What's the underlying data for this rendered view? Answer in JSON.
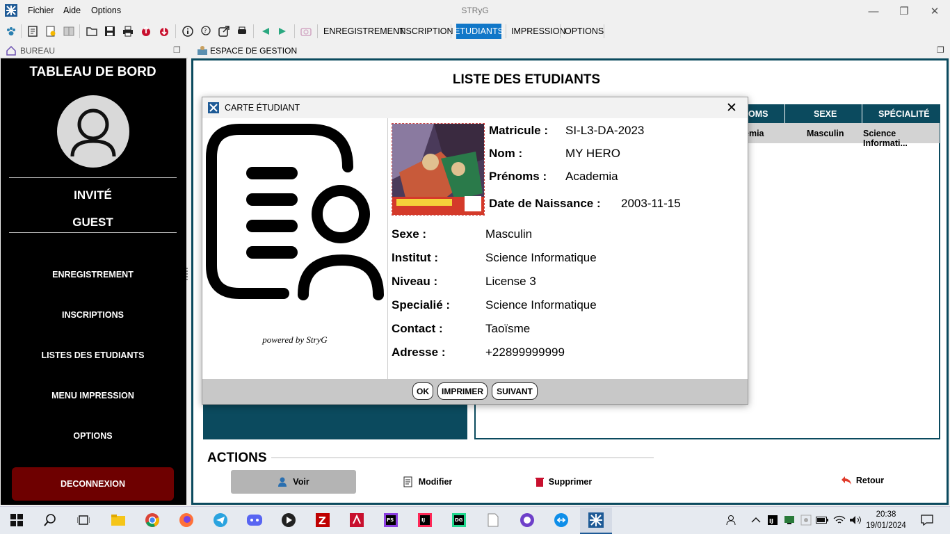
{
  "window": {
    "title": "STRyG",
    "menu": [
      "Fichier",
      "Aide",
      "Options"
    ]
  },
  "toolbar": {
    "links": [
      "ENREGISTREMENT",
      "INSCRIPTION",
      "ETUDIANTS",
      "IMPRESSION",
      "OPTIONS"
    ]
  },
  "left_panel": {
    "header": "BUREAU",
    "dashboard_title": "TABLEAU DE BORD",
    "user_role": "INVITÉ",
    "user_name": "GUEST",
    "nav": [
      "ENREGISTREMENT",
      "INSCRIPTIONS",
      "LISTES DES ETUDIANTS",
      "MENU IMPRESSION",
      "OPTIONS"
    ],
    "logout": "DECONNEXION"
  },
  "main_panel": {
    "header": "ESPACE DE GESTION",
    "list_title": "LISTE DES ETUDIANTS",
    "table": {
      "headers": [
        "OMS",
        "SEXE",
        "SPÉCIALITÉ"
      ],
      "rows": [
        [
          "emia",
          "Masculin",
          "Science Informati..."
        ]
      ]
    },
    "actions_title": "ACTIONS",
    "actions": [
      "Voir",
      "Modifier",
      "Supprimer",
      "Retour"
    ]
  },
  "dialog": {
    "title": "CARTE ÉTUDIANT",
    "powered": "powered by StryG",
    "fields": [
      {
        "label": "Matricule :",
        "value": "SI-L3-DA-2023"
      },
      {
        "label": "Nom :",
        "value": "MY HERO"
      },
      {
        "label": "Prénoms :",
        "value": "Academia"
      },
      {
        "label": "Date de Naissance :",
        "value": "2003-11-15"
      },
      {
        "label": "Sexe :",
        "value": "Masculin"
      },
      {
        "label": "Institut :",
        "value": "Science Informatique"
      },
      {
        "label": "Niveau :",
        "value": "License 3"
      },
      {
        "label": "Specialié :",
        "value": "Science Informatique"
      },
      {
        "label": "Contact :",
        "value": "Taoïsme"
      },
      {
        "label": "Adresse :",
        "value": "+22899999999"
      }
    ],
    "buttons": [
      "OK",
      "IMPRIMER",
      "SUIVANT"
    ]
  },
  "taskbar": {
    "time": "20:38",
    "date": "19/01/2024"
  },
  "colors": {
    "teal": "#0b4a5e",
    "accent": "#1177c8",
    "logout": "#6e0000"
  }
}
